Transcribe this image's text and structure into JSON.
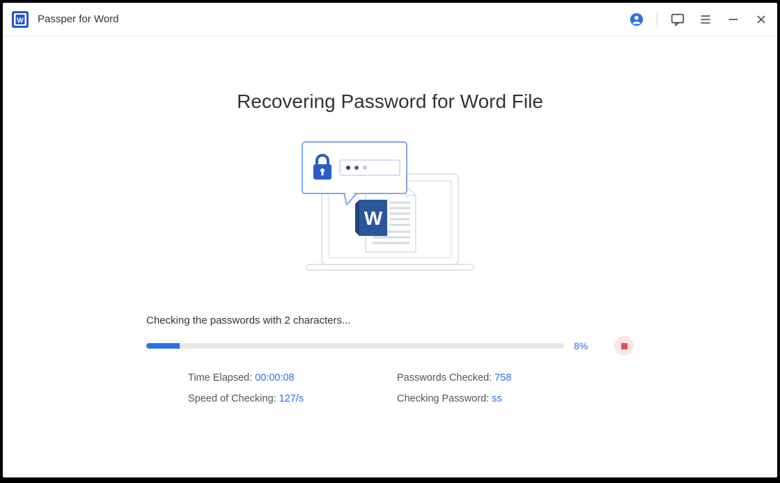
{
  "app": {
    "title": "Passper for Word"
  },
  "main": {
    "heading": "Recovering Password for Word File",
    "status_text": "Checking the passwords with 2 characters..."
  },
  "progress": {
    "percent_label": "8%",
    "percent_value": 8
  },
  "stats": {
    "time_elapsed_label": "Time Elapsed: ",
    "time_elapsed_value": "00:00:08",
    "passwords_checked_label": "Passwords Checked: ",
    "passwords_checked_value": "758",
    "speed_label": "Speed of Checking: ",
    "speed_value": "127/s",
    "current_label": "Checking Password: ",
    "current_value": "ss"
  },
  "colors": {
    "accent": "#2972e6",
    "danger": "#e84d4d"
  }
}
